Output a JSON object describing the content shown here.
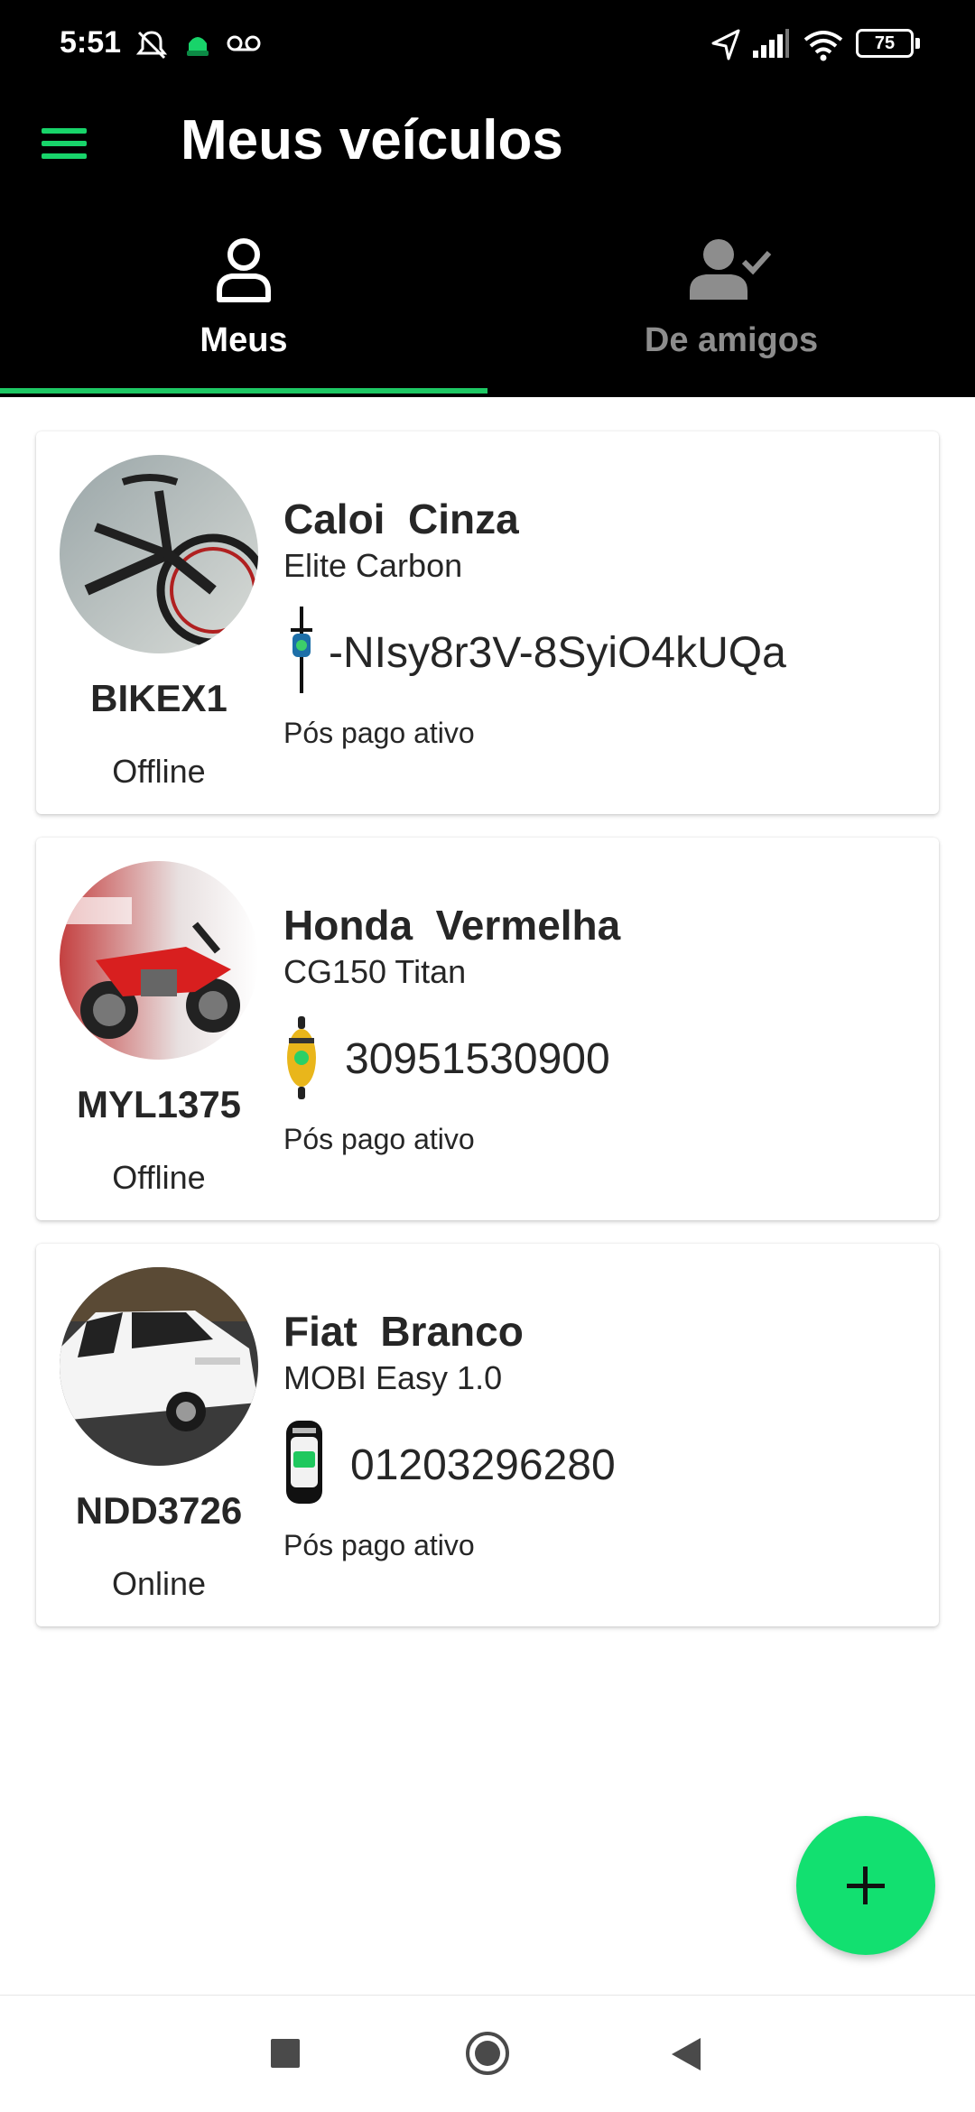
{
  "status_bar": {
    "time": "5:51",
    "battery": "75",
    "icons": [
      "mute-icon",
      "app-notification-icon",
      "voicemail-icon",
      "location-icon",
      "signal-icon",
      "wifi-icon",
      "battery-icon"
    ]
  },
  "app_bar": {
    "title": "Meus veículos",
    "menu_icon": "hamburger-menu-icon"
  },
  "tabs": [
    {
      "label": "Meus",
      "icon": "person-icon",
      "active": true
    },
    {
      "label": "De amigos",
      "icon": "person-check-icon",
      "active": false
    }
  ],
  "vehicles": [
    {
      "name": "Caloi  Cinza",
      "model": "Elite Carbon",
      "tracker_id": "-NIsy8r3V-8SyiO4kUQa",
      "tracker_icon": "bicycle-icon",
      "plan": "Pós pago ativo",
      "plate": "BIKEX1",
      "status": "Offline",
      "photo": "bicycle-photo"
    },
    {
      "name": "Honda  Vermelha",
      "model": "CG150 Titan",
      "tracker_id": "30951530900",
      "tracker_icon": "motorcycle-icon",
      "plan": "Pós pago ativo",
      "plate": "MYL1375",
      "status": "Offline",
      "photo": "motorcycle-photo"
    },
    {
      "name": "Fiat  Branco",
      "model": "MOBI Easy 1.0",
      "tracker_id": "01203296280",
      "tracker_icon": "car-icon",
      "plan": "Pós pago ativo",
      "plate": "NDD3726",
      "status": "Online",
      "photo": "car-photo"
    }
  ],
  "fab": {
    "icon": "plus-icon"
  },
  "nav_bar": {
    "buttons": [
      "recents-icon",
      "home-icon",
      "back-icon"
    ]
  },
  "colors": {
    "accent": "#1ec864",
    "fab": "#12e070",
    "header_bg": "#000000",
    "inactive_tab": "#8d8d8d"
  }
}
